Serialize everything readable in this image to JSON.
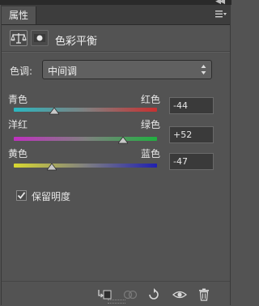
{
  "window": {
    "collapse_glyph": "◀◀",
    "close_glyph": "✕"
  },
  "tab": {
    "label": "属性"
  },
  "panel_menu_icon": "panel-menu-icon",
  "adjustment": {
    "title": "色彩平衡",
    "icons": [
      "color-balance-icon",
      "mask-icon"
    ]
  },
  "tone": {
    "label": "色调:",
    "value": "中间调"
  },
  "sliders": [
    {
      "left_label": "青色",
      "right_label": "红色",
      "value": "-44",
      "number": -44,
      "min": -100,
      "max": 100,
      "gradient_from": "#2ab7c0",
      "gradient_to": "#c83030"
    },
    {
      "left_label": "洋红",
      "right_label": "绿色",
      "value": "+52",
      "number": 52,
      "min": -100,
      "max": 100,
      "gradient_from": "#c030c0",
      "gradient_to": "#20b040"
    },
    {
      "left_label": "黄色",
      "right_label": "蓝色",
      "value": "-47",
      "number": -47,
      "min": -100,
      "max": 100,
      "gradient_from": "#d8d830",
      "gradient_to": "#2020b0"
    }
  ],
  "preserve_luminosity": {
    "label": "保留明度",
    "checked": true
  },
  "toolbar_icons": [
    "clip-to-layer-icon",
    "view-previous-icon",
    "reset-icon",
    "visibility-eye-icon",
    "trash-icon"
  ]
}
